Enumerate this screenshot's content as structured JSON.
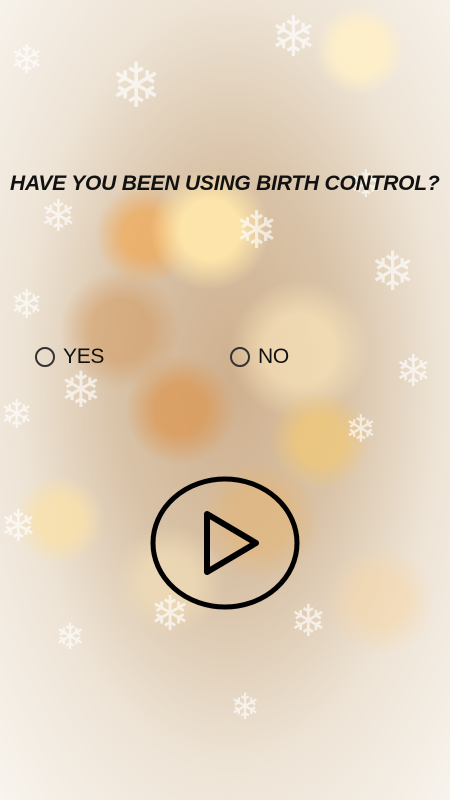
{
  "question": {
    "text": "HAVE YOU BEEN USING BIRTH CONTROL?"
  },
  "options": [
    {
      "label": "YES",
      "selected": false
    },
    {
      "label": "NO",
      "selected": false
    }
  ],
  "play_button": {
    "icon": "play-icon"
  },
  "background": {
    "theme": "golden bokeh with snowflakes",
    "colors": {
      "warm": "#d9b48a",
      "light": "#f8f4ee",
      "text": "#111111"
    }
  }
}
